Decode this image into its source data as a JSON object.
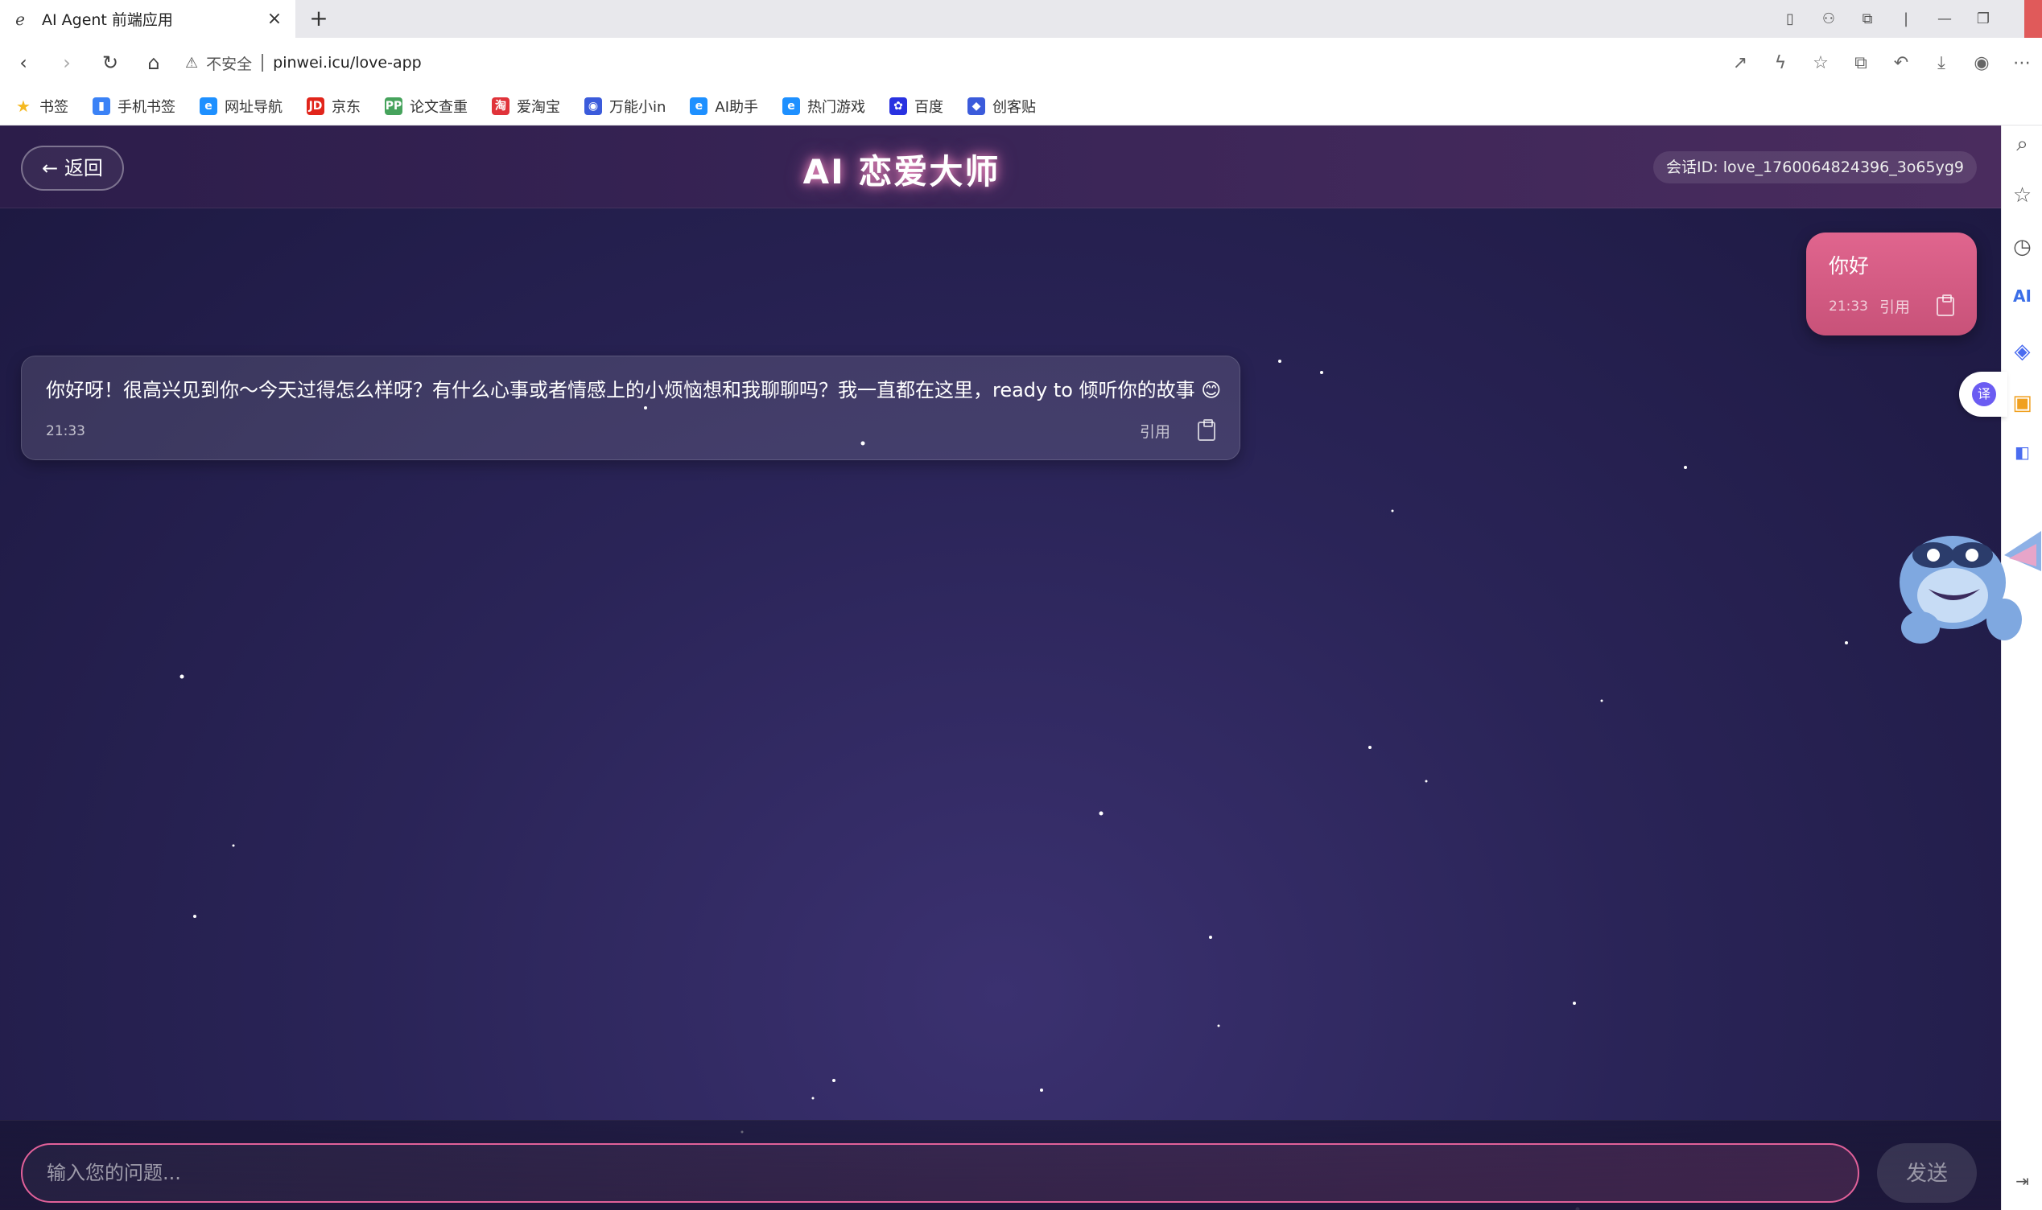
{
  "browser": {
    "tab_title": "AI Agent 前端应用",
    "tab_close": "×",
    "new_tab": "+",
    "url_insecure": "不安全",
    "url": "pinwei.icu/love-app",
    "bookmarks": [
      {
        "label": "书签",
        "icon": "star-icon",
        "color": "#f5b921"
      },
      {
        "label": "手机书签",
        "icon": "phone-bookmark-icon",
        "color": "#3b82f6"
      },
      {
        "label": "网址导航",
        "icon": "browser-e-icon",
        "color": "#1e90ff"
      },
      {
        "label": "京东",
        "icon": "jd-icon",
        "color": "#e1251b"
      },
      {
        "label": "论文查重",
        "icon": "pp-icon",
        "color": "#46a35c"
      },
      {
        "label": "爱淘宝",
        "icon": "taobao-icon",
        "color": "#e0333a"
      },
      {
        "label": "万能小in",
        "icon": "robot-icon",
        "color": "#3b5bdb"
      },
      {
        "label": "AI助手",
        "icon": "browser-e-icon",
        "color": "#1e90ff"
      },
      {
        "label": "热门游戏",
        "icon": "browser-e-icon",
        "color": "#1e90ff"
      },
      {
        "label": "百度",
        "icon": "baidu-paw-icon",
        "color": "#2932e1"
      },
      {
        "label": "创客贴",
        "icon": "chuangke-icon",
        "color": "#3b5bdb"
      }
    ]
  },
  "app": {
    "back_label": "← 返回",
    "title": "AI 恋爱大师",
    "session_label": "会话ID: love_1760064824396_3o65yg9",
    "messages": {
      "user": {
        "text": "你好",
        "time": "21:33",
        "quote": "引用"
      },
      "ai": {
        "text": "你好呀！很高兴见到你～今天过得怎么样呀？有什么心事或者情感上的小烦恼想和我聊聊吗？我一直都在这里，ready to 倾听你的故事 😊",
        "time": "21:33",
        "quote": "引用"
      }
    },
    "input": {
      "placeholder": "输入您的问题..."
    },
    "send_label": "发送"
  },
  "sidebar": {
    "translate_label": "译"
  },
  "colors": {
    "accent_pink": "#e0658e",
    "input_border": "#e2619a",
    "bg_dark": "#2a2457"
  }
}
